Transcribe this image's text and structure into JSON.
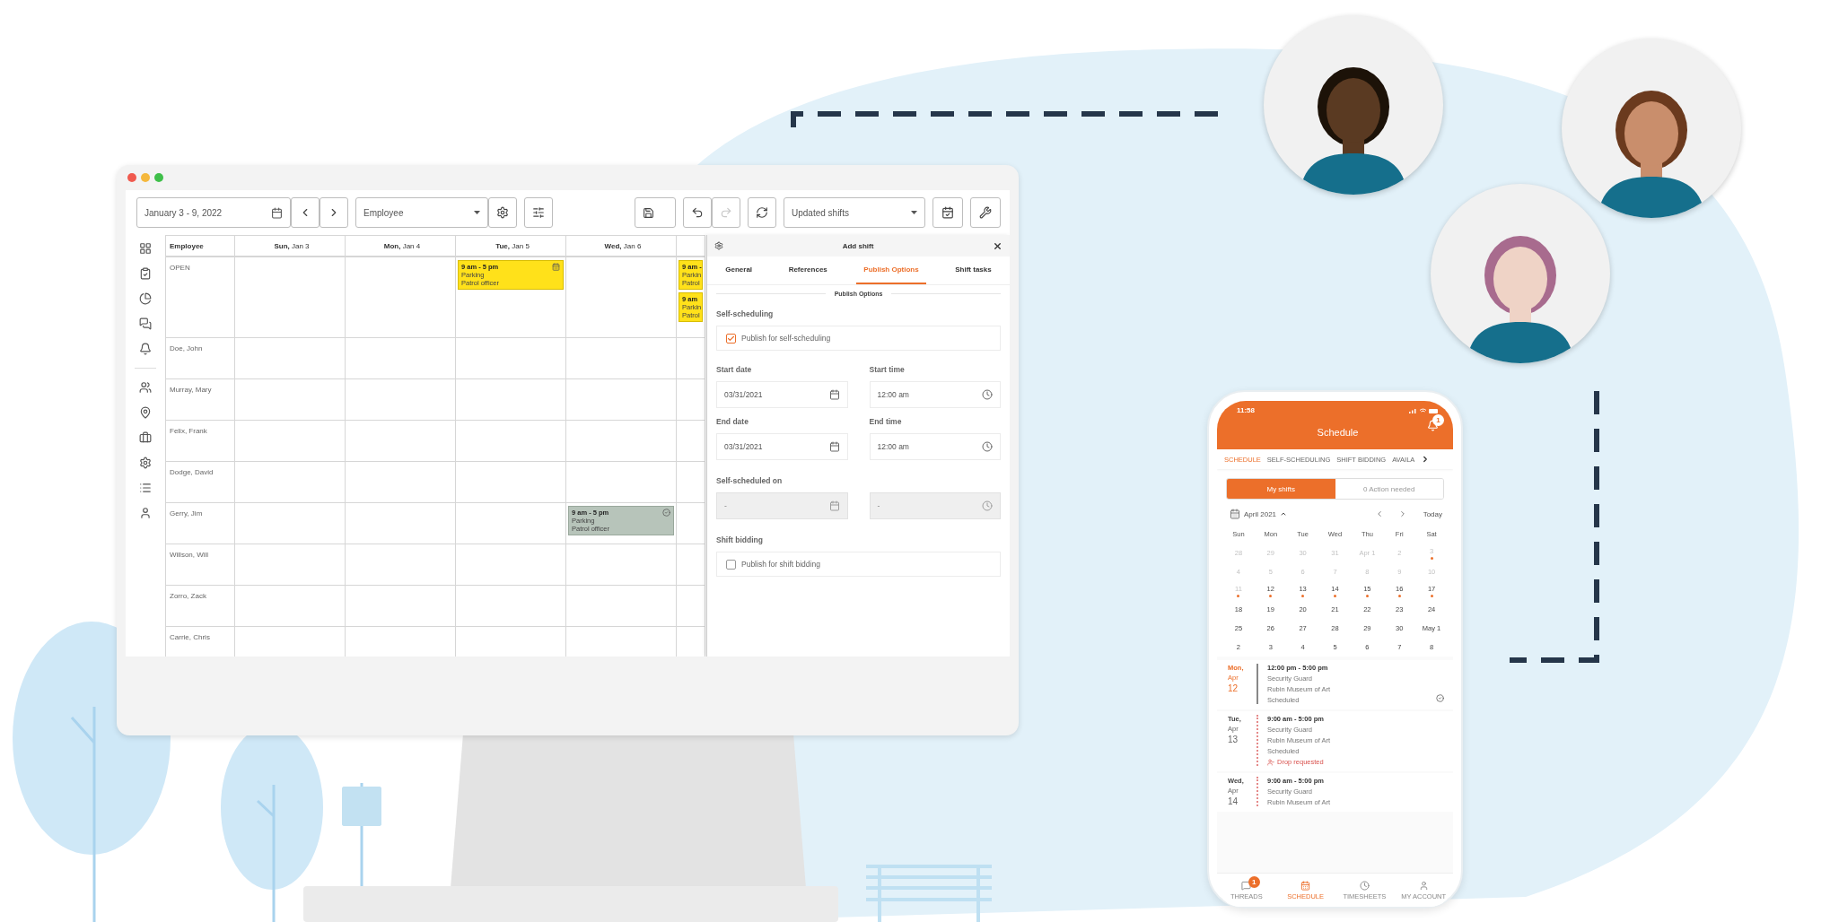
{
  "toolbar": {
    "date_range": "January 3 - 9, 2022",
    "group_by": "Employee",
    "filter": "Updated shifts"
  },
  "schedule": {
    "employee_heading": "Employee",
    "columns": [
      "**Sun,** Jan 3",
      "**Mon,** Jan 4",
      "**Tue,** Jan 5",
      "**Wed,** Jan 6"
    ],
    "rows": [
      {
        "name": "OPEN",
        "cells": [
          [],
          [],
          [
            {
              "kind": "open",
              "time": "9 am - 5 pm",
              "place": "Parking",
              "role": "Patrol officer"
            }
          ],
          [],
          [
            {
              "kind": "open",
              "time": "9 am -",
              "place": "Parkin",
              "role": "Patrol"
            },
            {
              "kind": "open",
              "time": "9 am",
              "place": "Parkin",
              "role": "Patrol"
            }
          ]
        ]
      },
      {
        "name": "Doe, John",
        "cells": [
          [],
          [],
          [],
          [],
          []
        ]
      },
      {
        "name": "Murray, Mary",
        "cells": [
          [],
          [],
          [],
          [],
          []
        ]
      },
      {
        "name": "Felix, Frank",
        "cells": [
          [],
          [],
          [],
          [],
          []
        ]
      },
      {
        "name": "Dodge, David",
        "cells": [
          [],
          [],
          [],
          [],
          []
        ]
      },
      {
        "name": "Gerry, Jim",
        "cells": [
          [],
          [],
          [],
          [
            {
              "kind": "confirmed",
              "time": "9 am - 5 pm",
              "place": "Parking",
              "role": "Patrol officer"
            }
          ],
          []
        ]
      },
      {
        "name": "Willson, Will",
        "cells": [
          [],
          [],
          [],
          [],
          []
        ]
      },
      {
        "name": "Zorro, Zack",
        "cells": [
          [],
          [],
          [],
          [],
          []
        ]
      },
      {
        "name": "Carrie, Chris",
        "cells": [
          [],
          [],
          [],
          [],
          []
        ]
      }
    ]
  },
  "panel": {
    "title": "Add shift",
    "tabs": [
      {
        "label": "General",
        "selected": false
      },
      {
        "label": "References",
        "selected": false
      },
      {
        "label": "Publish Options",
        "selected": true
      },
      {
        "label": "Shift tasks",
        "selected": false
      }
    ],
    "section_title": "Publish Options",
    "sections": [
      {
        "kind": "checkbox",
        "heading": "Self-scheduling",
        "label": "Publish for self-scheduling",
        "checked": true
      },
      {
        "kind": "fields",
        "fields": [
          {
            "label": "Start date",
            "value": "03/31/2021",
            "kind": "date",
            "disabled": false
          },
          {
            "label": "Start time",
            "value": "12:00 am",
            "kind": "time",
            "disabled": false
          },
          {
            "label": "End date",
            "value": "03/31/2021",
            "kind": "date",
            "disabled": false
          },
          {
            "label": "End time",
            "value": "12:00 am",
            "kind": "time",
            "disabled": false
          }
        ]
      },
      {
        "kind": "fields",
        "heading": "Self-scheduled on",
        "fields": [
          {
            "value": "-",
            "kind": "date",
            "disabled": true
          },
          {
            "value": "-",
            "kind": "time",
            "disabled": true
          }
        ]
      },
      {
        "kind": "checkbox",
        "heading": "Shift bidding",
        "label": "Publish for shift bidding",
        "checked": false
      }
    ]
  },
  "phone": {
    "status_time": "11:58",
    "title": "Schedule",
    "bell_badge": "1",
    "tabs": [
      {
        "label": "SCHEDULE",
        "selected": true
      },
      {
        "label": "SELF-SCHEDULING",
        "selected": false
      },
      {
        "label": "SHIFT BIDDING",
        "selected": false
      },
      {
        "label": "AVAILA",
        "selected": false
      }
    ],
    "segments": [
      {
        "label": "My shifts",
        "selected": true
      },
      {
        "label": "0 Action needed",
        "selected": false
      }
    ],
    "month": "April 2021",
    "today": "Today",
    "weekdays": [
      "Sun",
      "Mon",
      "Tue",
      "Wed",
      "Thu",
      "Fri",
      "Sat"
    ],
    "weeks": [
      [
        {
          "label": "28",
          "muted": true,
          "dot": false
        },
        {
          "label": "29",
          "muted": true,
          "dot": false
        },
        {
          "label": "30",
          "muted": true,
          "dot": false
        },
        {
          "label": "31",
          "muted": true,
          "dot": false
        },
        {
          "label": "Apr 1",
          "muted": true,
          "dot": false
        },
        {
          "label": "2",
          "muted": true,
          "dot": false
        },
        {
          "label": "3",
          "muted": true,
          "dot": true
        }
      ],
      [
        {
          "label": "4",
          "muted": true,
          "dot": false
        },
        {
          "label": "5",
          "muted": true,
          "dot": false
        },
        {
          "label": "6",
          "muted": true,
          "dot": false
        },
        {
          "label": "7",
          "muted": true,
          "dot": false
        },
        {
          "label": "8",
          "muted": true,
          "dot": false
        },
        {
          "label": "9",
          "muted": true,
          "dot": false
        },
        {
          "label": "10",
          "muted": true,
          "dot": false
        }
      ],
      [
        {
          "label": "11",
          "muted": true,
          "dot": true
        },
        {
          "label": "12",
          "muted": false,
          "dot": true
        },
        {
          "label": "13",
          "muted": false,
          "dot": true
        },
        {
          "label": "14",
          "muted": false,
          "dot": true
        },
        {
          "label": "15",
          "muted": false,
          "dot": true
        },
        {
          "label": "16",
          "muted": false,
          "dot": true
        },
        {
          "label": "17",
          "muted": false,
          "dot": true
        }
      ],
      [
        {
          "label": "18",
          "muted": false,
          "dot": false
        },
        {
          "label": "19",
          "muted": false,
          "dot": false
        },
        {
          "label": "20",
          "muted": false,
          "dot": false
        },
        {
          "label": "21",
          "muted": false,
          "dot": false
        },
        {
          "label": "22",
          "muted": false,
          "dot": false
        },
        {
          "label": "23",
          "muted": false,
          "dot": false
        },
        {
          "label": "24",
          "muted": false,
          "dot": false
        }
      ],
      [
        {
          "label": "25",
          "muted": false,
          "dot": false
        },
        {
          "label": "26",
          "muted": false,
          "dot": false
        },
        {
          "label": "27",
          "muted": false,
          "dot": false
        },
        {
          "label": "28",
          "muted": false,
          "dot": false
        },
        {
          "label": "29",
          "muted": false,
          "dot": false
        },
        {
          "label": "30",
          "muted": false,
          "dot": false
        },
        {
          "label": "May 1",
          "muted": false,
          "dot": false
        }
      ],
      [
        {
          "label": "2",
          "muted": false,
          "dot": false
        },
        {
          "label": "3",
          "muted": false,
          "dot": false
        },
        {
          "label": "4",
          "muted": false,
          "dot": false
        },
        {
          "label": "5",
          "muted": false,
          "dot": false
        },
        {
          "label": "6",
          "muted": false,
          "dot": false
        },
        {
          "label": "7",
          "muted": false,
          "dot": false
        },
        {
          "label": "8",
          "muted": false,
          "dot": false
        }
      ]
    ],
    "agenda": [
      {
        "kind": "scheduled",
        "highlight": true,
        "weekday": "Mon,",
        "month": "Apr",
        "day": "12",
        "time": "12:00 pm - 5:00 pm",
        "lines": [
          "Security Guard",
          "Rubin Museum of Art",
          "Scheduled"
        ]
      },
      {
        "kind": "drop",
        "highlight": false,
        "weekday": "Tue,",
        "month": "Apr",
        "day": "13",
        "time": "9:00 am - 5:00 pm",
        "lines": [
          "Security Guard",
          "Rubin Museum of Art",
          "Scheduled"
        ],
        "note": "Drop requested"
      },
      {
        "kind": "drop",
        "highlight": false,
        "weekday": "Wed,",
        "month": "Apr",
        "day": "14",
        "time": "9:00 am - 5:00 pm",
        "lines": [
          "Security Guard",
          "Rubin Museum of Art"
        ]
      }
    ],
    "nav": [
      {
        "label": "THREADS",
        "selected": false,
        "badge": "1"
      },
      {
        "label": "SCHEDULE",
        "selected": true
      },
      {
        "label": "TIMESHEETS",
        "selected": false
      },
      {
        "label": "MY ACCOUNT",
        "selected": false
      }
    ]
  }
}
